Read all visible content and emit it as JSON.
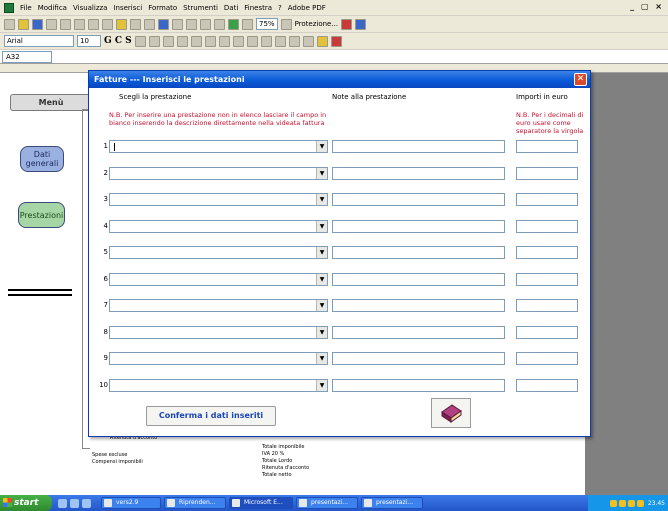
{
  "excel": {
    "menu": [
      "File",
      "Modifica",
      "Visualizza",
      "Inserisci",
      "Formato",
      "Strumenti",
      "Dati",
      "Finestra",
      "?",
      "Adobe PDF"
    ],
    "window_controls": "_ ▢ ×",
    "toolbar": {
      "zoom": "75%",
      "protection": "Protezione...",
      "font_name": "Arial",
      "font_size": "10",
      "format_glyphs": "G C S"
    },
    "name_box": "A32"
  },
  "sheet": {
    "menu_button": "Menù",
    "dati_button": "Dati generali",
    "prestazioni_button": "Prestazioni",
    "invoice_lines": [
      "Ritenuta d'acconto",
      "Spese escluse",
      "Compensi imponibili",
      "Totale imponibile",
      "IVA 20 %",
      "Totale Lordo",
      "Ritenuta d'acconto",
      "Totale netto"
    ]
  },
  "dialog": {
    "title": "Fatture --- Inserisci le prestazioni",
    "col_service": "Scegli la prestazione",
    "col_notes": "Note alla prestazione",
    "col_amount": "Importi in euro",
    "note_service": "N.B. Per inserire una prestazione non in elenco lasciare il campo in bianco inserendo la descrizione direttamente nella videata fattura",
    "note_amount": "N.B. Per i decimali di euro usare come separatore la virgola",
    "rows": [
      "1",
      "2",
      "3",
      "4",
      "5",
      "6",
      "7",
      "8",
      "9",
      "10"
    ],
    "confirm_label": "Conferma i dati inseriti"
  },
  "taskbar": {
    "start": "start",
    "tasks": [
      "vers2.9",
      "Riprenden...",
      "Microsoft E...",
      "presentazi...",
      "presentazi..."
    ],
    "clock": "23.45"
  }
}
